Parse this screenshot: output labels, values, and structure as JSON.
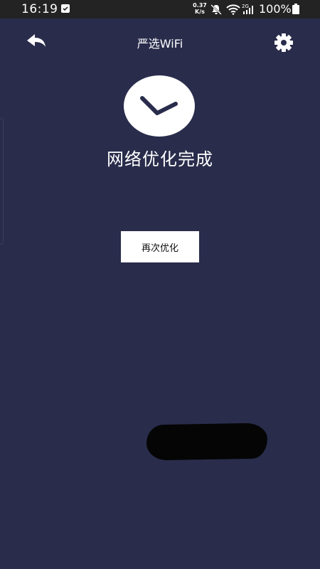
{
  "status_bar": {
    "time": "16:19",
    "net_speed_value": "0.37",
    "net_speed_unit": "K/s",
    "network_type": "2G",
    "battery": "100%"
  },
  "header": {
    "title": "严选WiFi",
    "back_icon": "back-arrow-icon",
    "settings_icon": "gear-icon"
  },
  "main": {
    "status_icon": "check-icon",
    "status_text": "网络优化完成",
    "reoptimize_label": "再次优化"
  },
  "colors": {
    "background": "#292c4b",
    "status_bar": "#232323",
    "button": "#ffffff"
  }
}
